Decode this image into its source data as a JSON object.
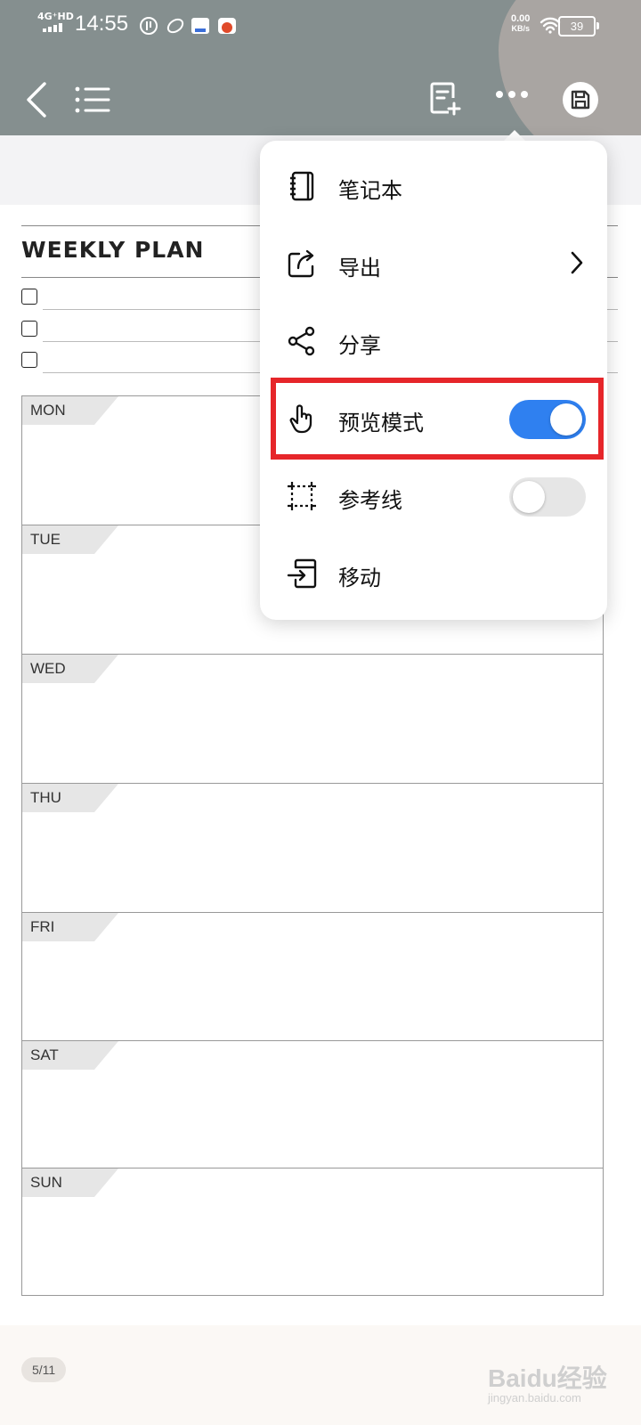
{
  "status_bar": {
    "network": "4G⁺HD",
    "time": "14:55",
    "net_speed_value": "0.00",
    "net_speed_unit": "KB/s",
    "battery": "39"
  },
  "header": {
    "back_icon": "chevron-left-icon",
    "list_icon": "list-icon",
    "add_page_icon": "add-page-icon",
    "more_icon": "more-dots-icon",
    "save_icon": "save-icon"
  },
  "plan": {
    "title": "WEEKLY PLAN",
    "days": [
      "MON",
      "TUE",
      "WED",
      "THU",
      "FRI",
      "SAT",
      "SUN"
    ]
  },
  "menu": {
    "items": [
      {
        "label": "笔记本",
        "icon": "notebook-icon"
      },
      {
        "label": "导出",
        "icon": "export-icon"
      },
      {
        "label": "分享",
        "icon": "share-icon"
      },
      {
        "label": "预览模式",
        "icon": "hand-pointer-icon",
        "toggle_on": true
      },
      {
        "label": "参考线",
        "icon": "guideline-icon",
        "toggle_on": false
      },
      {
        "label": "移动",
        "icon": "move-icon"
      }
    ],
    "toggle_on_color": "#2f80f0",
    "toggle_off_color": "#e6e6e6",
    "highlight_color": "#e6262a"
  },
  "footer": {
    "page_counter": "5/11",
    "watermark": "Baidu经验",
    "watermark_sub": "jingyan.baidu.com"
  }
}
